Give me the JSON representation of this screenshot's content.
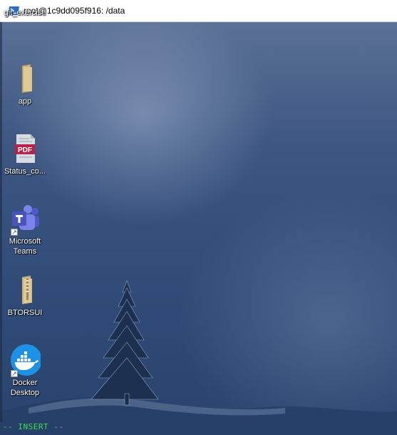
{
  "window": {
    "title": "root@1c9dd095f916: /data",
    "icon": "powershell-icon"
  },
  "desktop": {
    "icons": [
      {
        "label": "git_exercise",
        "icon": "folder-icon"
      },
      {
        "label": "app",
        "icon": "folder-icon"
      },
      {
        "label": "Status_co...",
        "icon": "pdf-icon",
        "badge": "PDF"
      },
      {
        "label": "Microsoft Teams",
        "icon": "teams-icon",
        "shortcut": true
      },
      {
        "label": "BTORSUI",
        "icon": "zip-folder-icon"
      },
      {
        "label": "Docker Desktop",
        "icon": "docker-icon",
        "shortcut": true
      }
    ]
  },
  "terminal": {
    "mode_indicator": "-- INSERT --"
  },
  "colors": {
    "mode_text": "#3ddc4a",
    "titlebar_bg": "#ffffff",
    "wallpaper": "#2f4a74"
  }
}
